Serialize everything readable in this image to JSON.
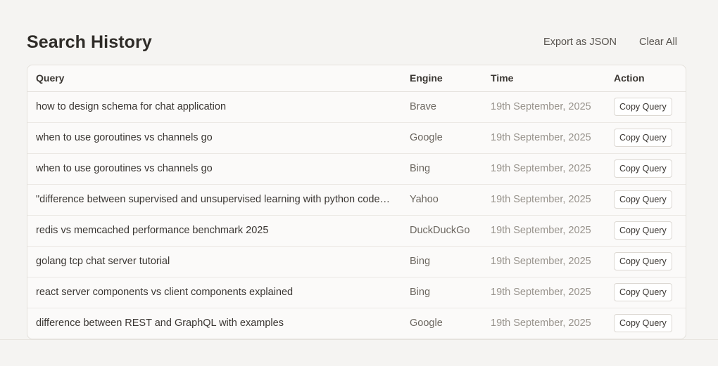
{
  "header": {
    "title": "Search History",
    "export_label": "Export as JSON",
    "clear_label": "Clear All"
  },
  "table": {
    "columns": [
      "Query",
      "Engine",
      "Time",
      "Action"
    ],
    "copy_label": "Copy Query",
    "rows": [
      {
        "query": "how to design schema for chat application",
        "engine": "Brave",
        "time": "19th September, 2025"
      },
      {
        "query": "when to use goroutines vs channels go",
        "engine": "Google",
        "time": "19th September, 2025"
      },
      {
        "query": "when to use goroutines vs channels go",
        "engine": "Bing",
        "time": "19th September, 2025"
      },
      {
        "query": "\"difference between supervised and unsupervised learning with python code examples\"",
        "engine": "Yahoo",
        "time": "19th September, 2025"
      },
      {
        "query": "redis vs memcached performance benchmark 2025",
        "engine": "DuckDuckGo",
        "time": "19th September, 2025"
      },
      {
        "query": "golang tcp chat server tutorial",
        "engine": "Bing",
        "time": "19th September, 2025"
      },
      {
        "query": "react server components vs client components explained",
        "engine": "Bing",
        "time": "19th September, 2025"
      },
      {
        "query": "difference between REST and GraphQL with examples",
        "engine": "Google",
        "time": "19th September, 2025"
      }
    ]
  }
}
